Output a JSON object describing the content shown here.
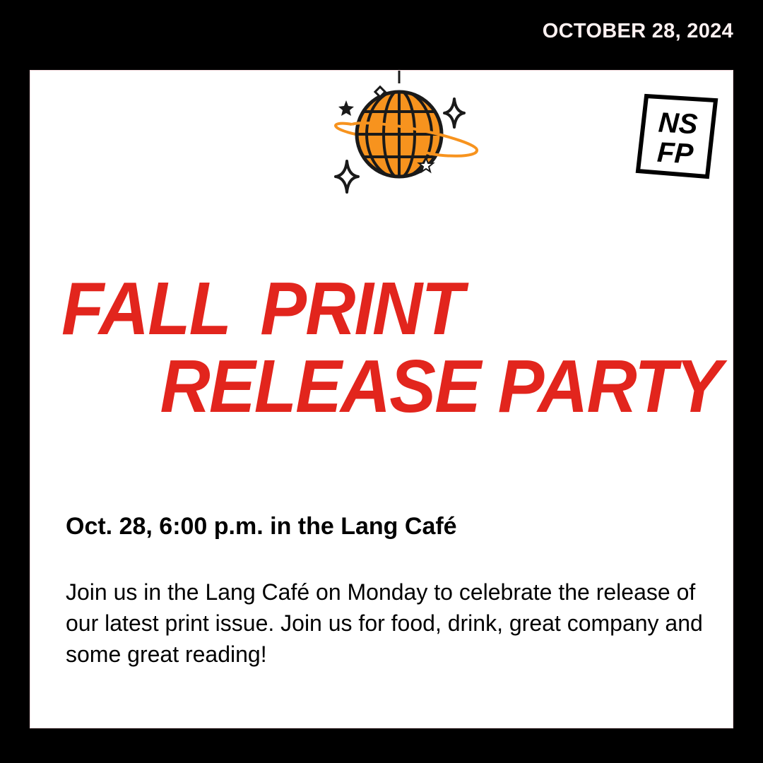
{
  "header": {
    "date": "OCTOBER 28, 2024"
  },
  "logo": {
    "line1": "NS",
    "line2": "FP"
  },
  "headline": {
    "line1": "FALL PRINT",
    "line2": "RELEASE PARTY"
  },
  "event": {
    "when_where": "Oct. 28, 6:00 p.m. in the Lang Café"
  },
  "description": {
    "text": "Join us in the Lang Café on Monday to celebrate the release of our latest print issue. Join us for food, drink, great company and some great reading!"
  },
  "colors": {
    "background": "#000000",
    "card": "#ffffff",
    "headline": "#e2251d",
    "disco_ball": "#f7931e",
    "date_text": "#fdf1f1"
  },
  "icons": {
    "illustration": "disco-ball-icon",
    "sparkles": "sparkle-icon",
    "logo": "nsfp-logo"
  }
}
